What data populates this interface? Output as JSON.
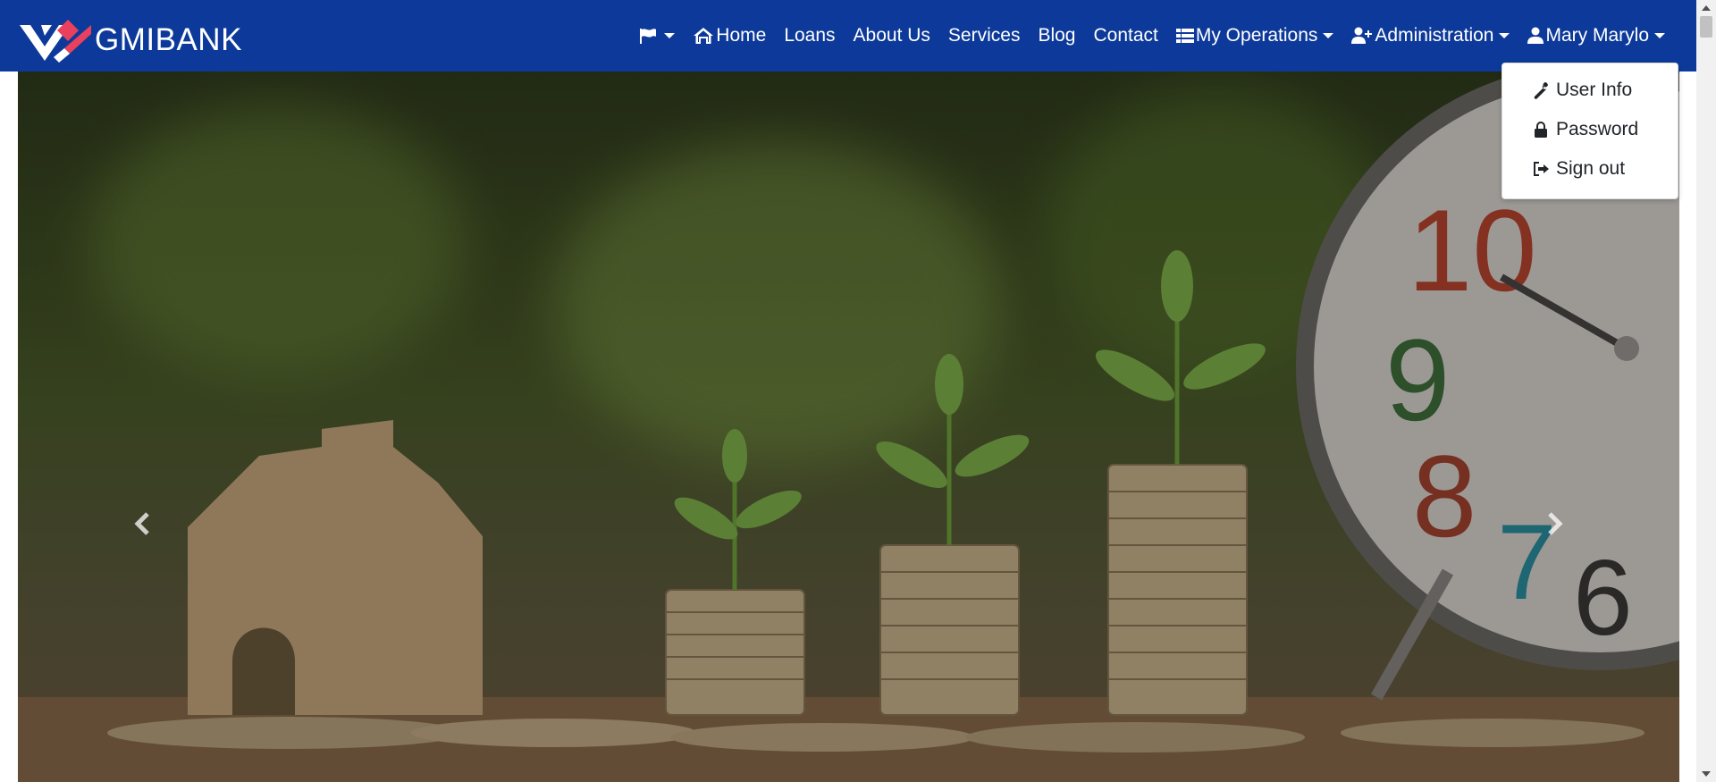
{
  "brand": {
    "name": "GMIBANK",
    "icon": "gmibank-logo"
  },
  "colors": {
    "navbar": "#0d3a9a",
    "logo_red": "#e8405d"
  },
  "nav": {
    "flag_icon": "flag-icon",
    "home": "Home",
    "loans": "Loans",
    "about": "About Us",
    "services": "Services",
    "blog": "Blog",
    "contact": "Contact",
    "my_operations": "My Operations",
    "administration": "Administration",
    "user": "Mary Marylo"
  },
  "user_menu": {
    "items": [
      {
        "label": "User Info",
        "icon": "wrench-icon"
      },
      {
        "label": "Password",
        "icon": "lock-icon"
      },
      {
        "label": "Sign out",
        "icon": "sign-out-icon"
      }
    ]
  },
  "carousel": {
    "prev_icon": "chevron-left-icon",
    "next_icon": "chevron-right-icon"
  }
}
